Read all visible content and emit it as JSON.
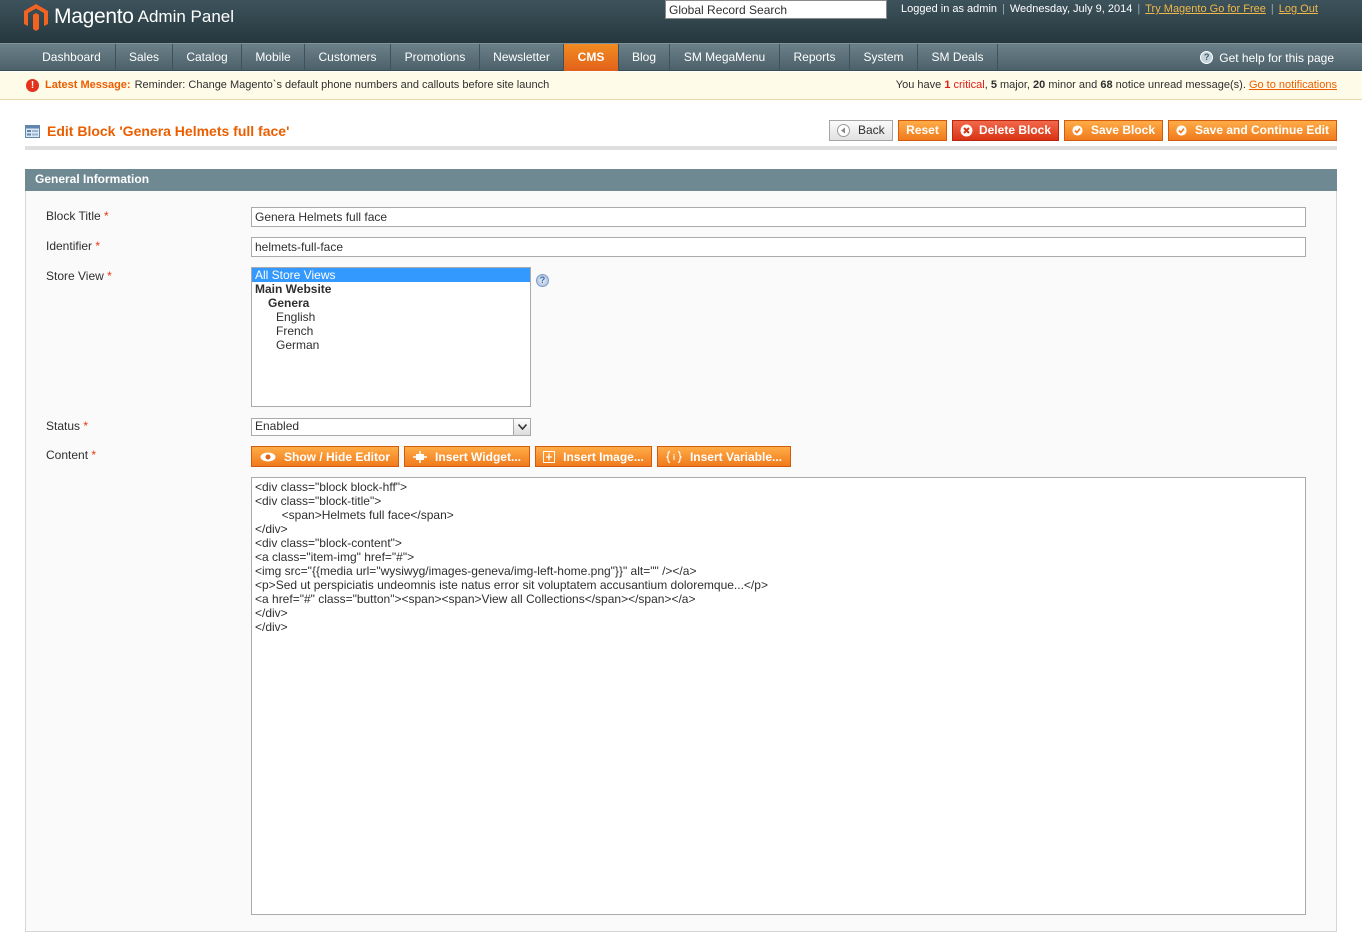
{
  "header": {
    "logo_text": "Magento",
    "logo_sub": "Admin Panel",
    "search_value": "Global Record Search",
    "logged_in": "Logged in as admin",
    "date": "Wednesday, July 9, 2014",
    "try_link": "Try Magento Go for Free",
    "logout_link": "Log Out",
    "brand_color": "#eb5e00"
  },
  "nav": {
    "items": [
      "Dashboard",
      "Sales",
      "Catalog",
      "Mobile",
      "Customers",
      "Promotions",
      "Newsletter",
      "CMS",
      "Blog",
      "SM MegaMenu",
      "Reports",
      "System",
      "SM Deals"
    ],
    "active": "CMS",
    "help": "Get help for this page"
  },
  "message": {
    "label": "Latest Message:",
    "text": "Reminder: Change Magento`s default phone numbers and callouts before site launch",
    "right_prefix": "You have",
    "critical_count": "1",
    "critical_label": "critical",
    "major_count": "5",
    "major_label": "major,",
    "minor_count": "20",
    "minor_label": "minor and",
    "notice_count": "68",
    "notice_label": "notice unread message(s).",
    "link": "Go to notifications"
  },
  "page": {
    "title": "Edit Block 'Genera Helmets full face'",
    "buttons": {
      "back": "Back",
      "reset": "Reset",
      "delete": "Delete Block",
      "save": "Save Block",
      "save_continue": "Save and Continue Edit"
    }
  },
  "form": {
    "section": "General Information",
    "required_mark": "*",
    "block_title_label": "Block Title",
    "block_title_value": "Genera Helmets full face",
    "identifier_label": "Identifier",
    "identifier_value": "helmets-full-face",
    "store_view_label": "Store View",
    "store_views": [
      "All Store Views",
      "Main Website",
      "Genera",
      "English",
      "French",
      "German"
    ],
    "status_label": "Status",
    "status_value": "Enabled",
    "content_label": "Content",
    "editor_buttons": {
      "show_hide": "Show / Hide Editor",
      "insert_widget": "Insert Widget...",
      "insert_image": "Insert Image...",
      "insert_variable": "Insert Variable..."
    },
    "content_value": "<div class=\"block block-hff\">\n<div class=\"block-title\">\n\t<span>Helmets full face</span>\n</div>\n<div class=\"block-content\">\n<a class=\"item-img\" href=\"#\">\n<img src=\"{{media url=\"wysiwyg/images-geneva/img-left-home.png\"}}\" alt=\"\" /></a>\n<p>Sed ut perspiciatis undeomnis iste natus error sit voluptatem accusantium doloremque...</p>\n<a href=\"#\" class=\"button\"><span><span>View all Collections</span></span></a>\n</div>\n</div>"
  }
}
